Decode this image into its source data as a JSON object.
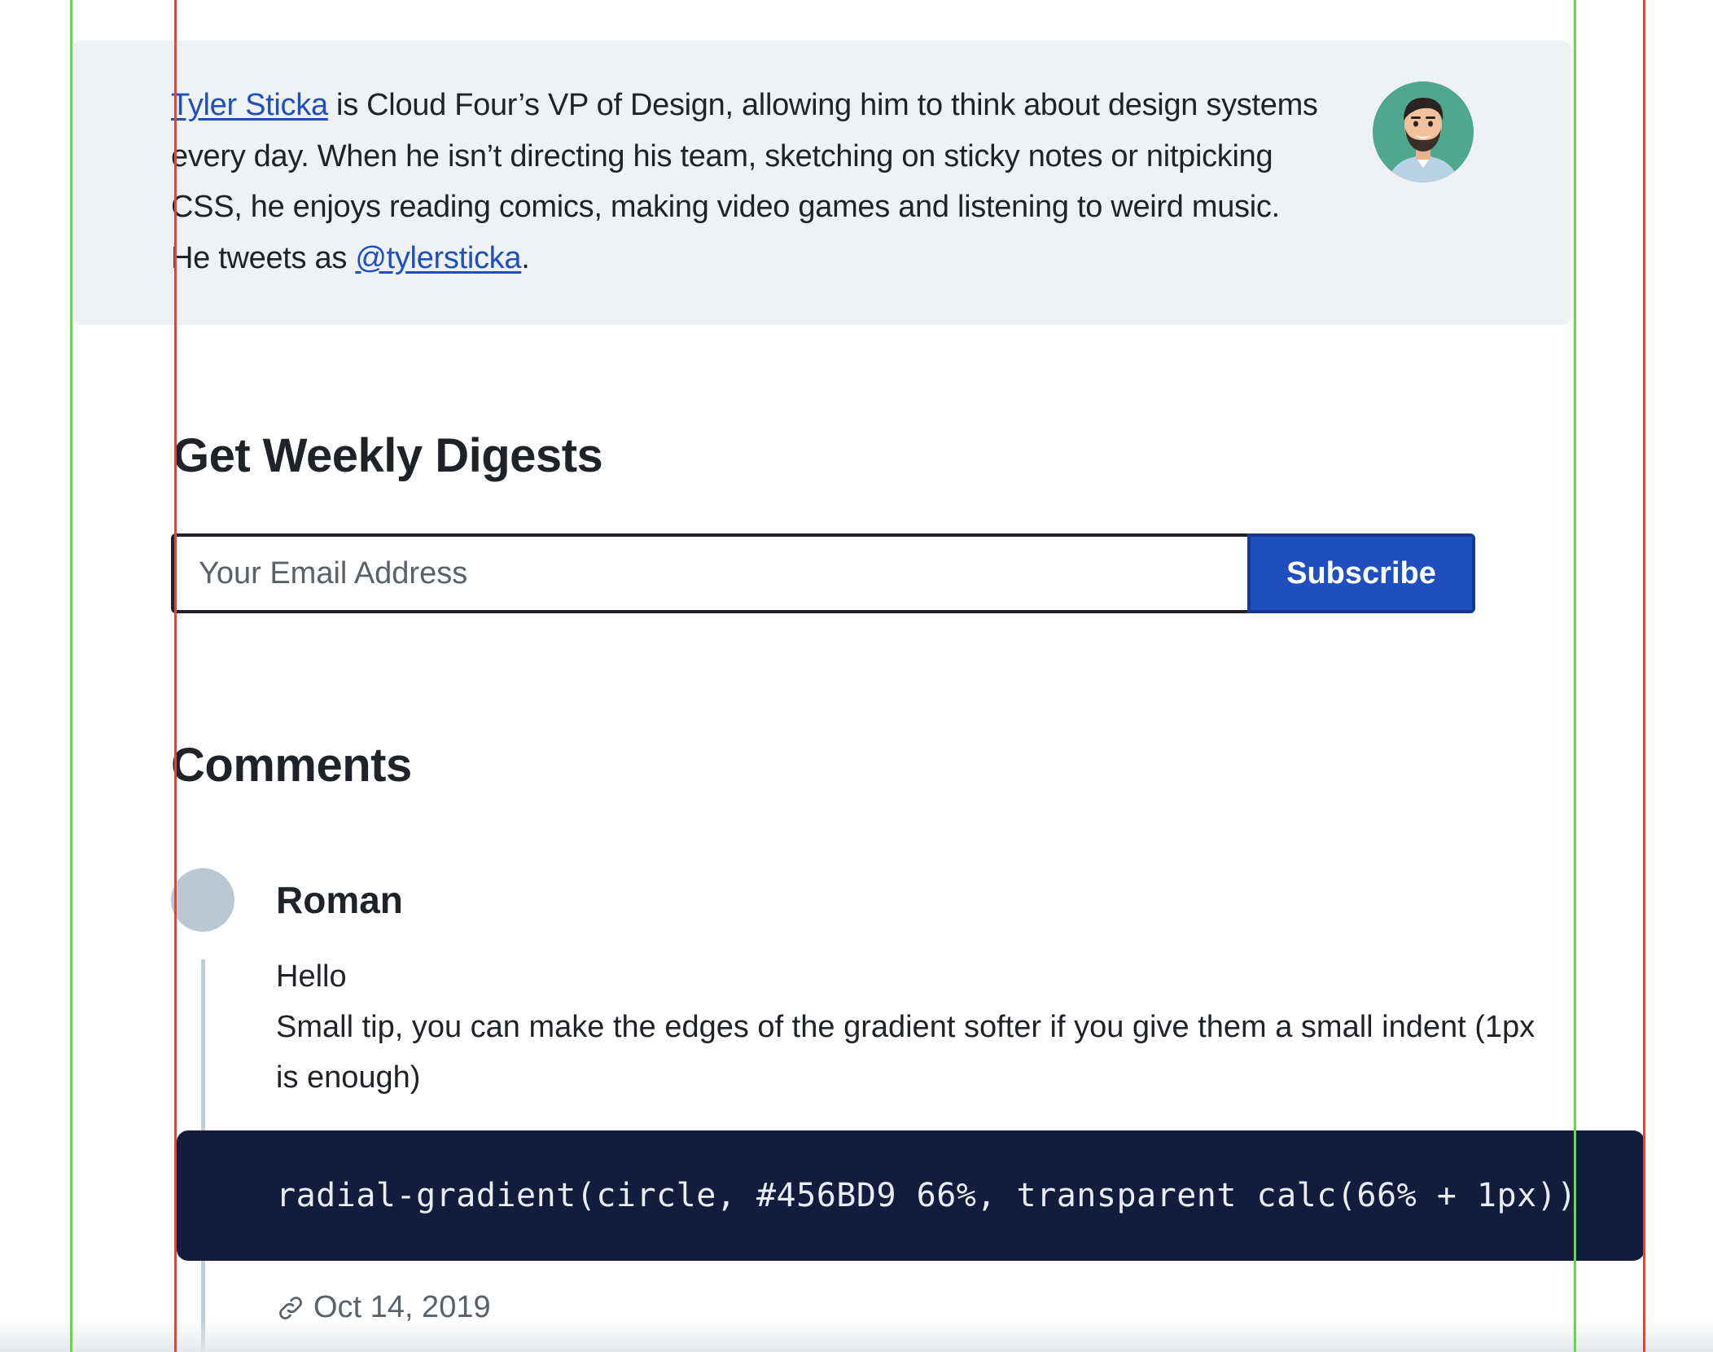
{
  "bio": {
    "author_name": "Tyler Sticka",
    "text_1": " is Cloud Four’s VP of Design, allowing him to think about design systems every day. When he isn’t directing his team, sketching on sticky notes or nitpicking CSS, he enjoys reading comics, making video games and listening to weird music. He tweets as ",
    "twitter_handle": "@tylersticka",
    "text_2": "."
  },
  "digest": {
    "heading": "Get Weekly Digests",
    "email_placeholder": "Your Email Address",
    "subscribe_label": "Subscribe"
  },
  "comments": {
    "heading": "Comments",
    "items": [
      {
        "author": "Roman",
        "lines": [
          "Hello",
          "Small tip, you can make the edges of the gradient softer if you give them a small indent (1px is enough)"
        ],
        "code": "radial-gradient(circle, #456BD9 66%, transparent calc(66% + 1px))",
        "date": "Oct 14, 2019"
      }
    ]
  },
  "colors": {
    "link": "#1f4fbf",
    "button_bg": "#1f4fbf",
    "code_bg": "#121c3c",
    "card_bg": "#eef2f5",
    "guide_green": "#5fdc4a",
    "guide_red": "#e0453a"
  },
  "icons": {
    "meta_icon": "link-icon",
    "author_avatar": "illustrated-avatar"
  }
}
